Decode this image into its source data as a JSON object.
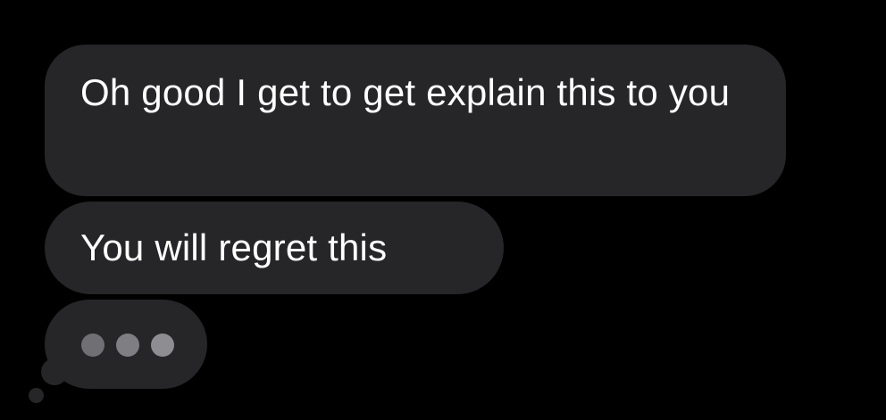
{
  "messages": [
    {
      "text": "Oh good I get to get explain this to you"
    },
    {
      "text": "You will regret this"
    }
  ],
  "typing_indicator": {
    "dot_count": 3
  },
  "colors": {
    "background": "#000000",
    "bubble": "#262629",
    "text": "#ffffff",
    "typing_dot": "#7e7e83"
  }
}
